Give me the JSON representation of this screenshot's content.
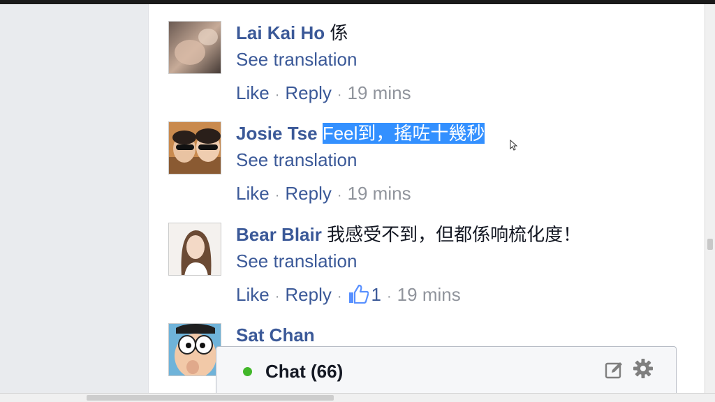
{
  "comments": [
    {
      "author": "Lai Kai Ho",
      "text": "係",
      "text_selected": "",
      "see_translation": "See translation",
      "like": "Like",
      "reply": "Reply",
      "likes": "",
      "time": "19 mins"
    },
    {
      "author": "Josie Tse",
      "text": "",
      "text_selected": "Feel到，搖咗十幾秒",
      "see_translation": "See translation",
      "like": "Like",
      "reply": "Reply",
      "likes": "",
      "time": "19 mins"
    },
    {
      "author": "Bear Blair",
      "text": "我感受不到，但都係响梳化度！",
      "text_selected": "",
      "see_translation": "See translation",
      "like": "Like",
      "reply": "Reply",
      "likes": "1",
      "time": "19 mins"
    },
    {
      "author": "Sat Chan",
      "text": "",
      "text_selected": "",
      "see_translation": "",
      "like": "",
      "reply": "",
      "likes": "",
      "time": ""
    }
  ],
  "separator": "·",
  "chat": {
    "label": "Chat (66)",
    "status_color": "#42b72a"
  },
  "icons": {
    "compose": "compose-icon",
    "settings": "gear-icon",
    "like": "thumbs-up-icon"
  },
  "colors": {
    "link": "#3b5998",
    "meta": "#90949c",
    "selection": "#3390ff"
  }
}
